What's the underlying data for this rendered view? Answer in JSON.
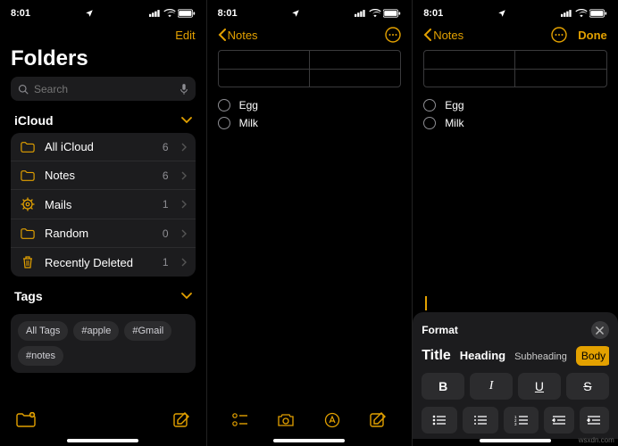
{
  "status": {
    "time": "8:01",
    "indicators": "􀋨 􀙇 􀛨"
  },
  "screen1": {
    "edit": "Edit",
    "title": "Folders",
    "search_placeholder": "Search",
    "icloud_header": "iCloud",
    "folders": [
      {
        "icon": "folder",
        "label": "All iCloud",
        "count": "6"
      },
      {
        "icon": "folder",
        "label": "Notes",
        "count": "6"
      },
      {
        "icon": "gear",
        "label": "Mails",
        "count": "1"
      },
      {
        "icon": "folder",
        "label": "Random",
        "count": "0"
      },
      {
        "icon": "trash",
        "label": "Recently Deleted",
        "count": "1"
      }
    ],
    "tags_header": "Tags",
    "tags": [
      "All Tags",
      "#apple",
      "#Gmail",
      "#notes"
    ]
  },
  "screen2": {
    "back": "Notes",
    "items": [
      "Egg",
      "Milk"
    ]
  },
  "screen3": {
    "back": "Notes",
    "done": "Done",
    "items": [
      "Egg",
      "Milk"
    ],
    "format": {
      "title": "Format",
      "styles": {
        "title": "Title",
        "heading": "Heading",
        "subheading": "Subheading",
        "body": "Body"
      },
      "biu": {
        "b": "B",
        "i": "I",
        "u": "U",
        "s": "S"
      }
    }
  },
  "watermark": "wsxdn.com"
}
